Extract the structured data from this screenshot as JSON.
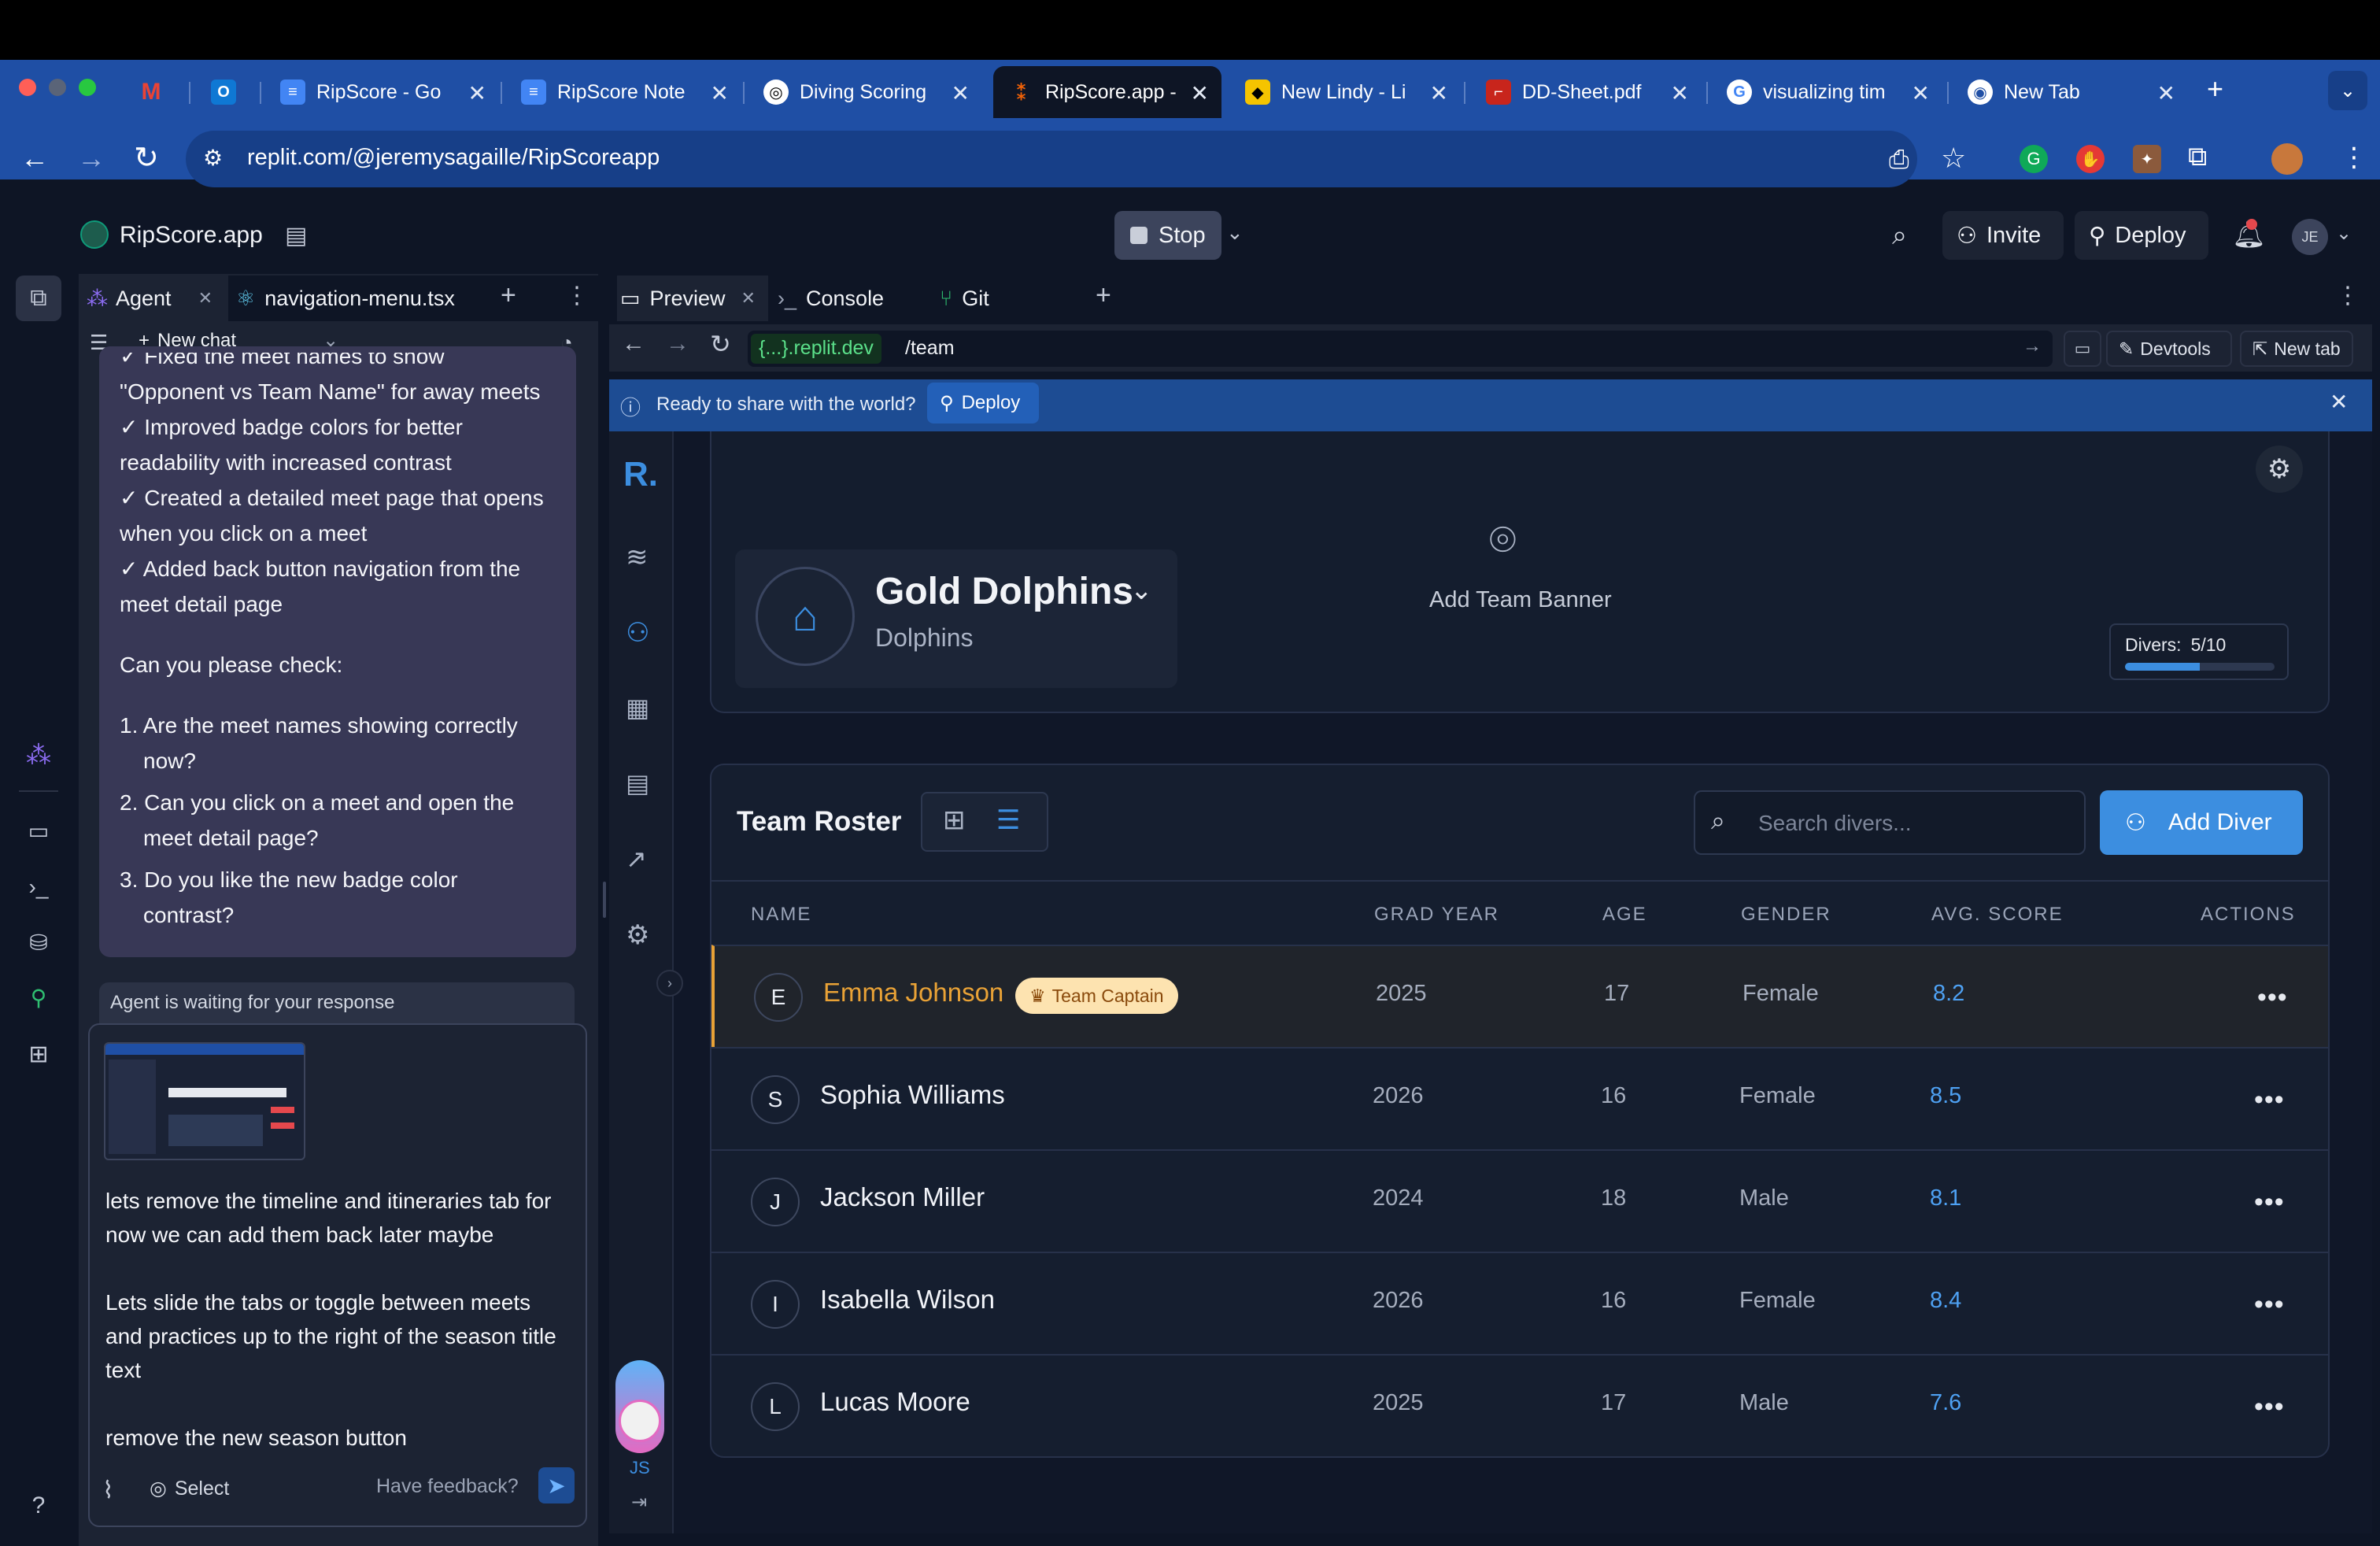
{
  "browser": {
    "tabs": [
      {
        "label": "",
        "icon": "gmail-icon"
      },
      {
        "label": "",
        "icon": "outlook-icon"
      },
      {
        "label": "RipScore - Go",
        "icon": "docs-icon"
      },
      {
        "label": "RipScore Note",
        "icon": "docs-icon"
      },
      {
        "label": "Diving Scoring",
        "icon": "openai-icon"
      },
      {
        "label": "RipScore.app -",
        "icon": "replit-icon"
      },
      {
        "label": "New Lindy - Li",
        "icon": "lindy-icon"
      },
      {
        "label": "DD-Sheet.pdf",
        "icon": "pdf-icon"
      },
      {
        "label": "visualizing tim",
        "icon": "google-icon"
      },
      {
        "label": "New Tab",
        "icon": "chrome-icon"
      }
    ],
    "url": "replit.com/@jeremysagaille/RipScoreapp"
  },
  "replit": {
    "project_name": "RipScore.app",
    "stop_label": "Stop",
    "invite_label": "Invite",
    "deploy_label": "Deploy",
    "avatar_initials": "JE"
  },
  "left_panel": {
    "tab_agent": "Agent",
    "tab_file": "navigation-menu.tsx",
    "new_chat": "New chat",
    "chat_lines": [
      "✓ Fixed the meet names to show",
      "\"Opponent vs Team Name\" for away meets",
      "✓ Improved badge colors for better",
      "readability with increased contrast",
      "✓ Created a detailed meet page that opens",
      "when you click on a meet",
      "✓ Added back button navigation from the",
      "meet detail page"
    ],
    "check_prompt": "Can you please check:",
    "check_items": [
      [
        "1. Are the meet names showing correctly",
        "now?"
      ],
      [
        "2. Can you click on a meet and open the",
        "meet detail page?"
      ],
      [
        "3. Do you like the new badge color",
        "contrast?"
      ]
    ],
    "waiting": "Agent is waiting for your response",
    "message_lines": [
      "lets remove the timeline and itineraries tab for",
      "now we can add them back later maybe",
      "",
      "Lets slide the tabs or toggle between meets",
      "and practices up to the right of the season title",
      "text",
      "",
      "remove the new season button"
    ],
    "select_label": "Select",
    "feedback_label": "Have feedback?"
  },
  "right_panel": {
    "tab_preview": "Preview",
    "tab_console": "Console",
    "tab_git": "Git",
    "url_host": "{...}.replit.dev",
    "url_path": "/team",
    "devtools": "Devtools",
    "new_tab": "New tab",
    "banner_text": "Ready to share with the world?",
    "banner_deploy": "Deploy",
    "side_initials": "JS"
  },
  "app": {
    "logo": "R.",
    "team_name": "Gold Dolphins",
    "team_sub": "Dolphins",
    "add_banner": "Add Team Banner",
    "divers_label": "Divers:",
    "divers_value": "5/10",
    "divers_fraction": 0.5,
    "roster_title": "Team Roster",
    "search_placeholder": "Search divers...",
    "add_diver": "Add Diver",
    "columns": [
      "NAME",
      "GRAD YEAR",
      "AGE",
      "GENDER",
      "AVG. SCORE",
      "ACTIONS"
    ],
    "captain_badge": "Team Captain",
    "accent": "#3c8ee0",
    "captain_color": "#e9a236",
    "rows": [
      {
        "initial": "E",
        "name": "Emma Johnson",
        "year": "2025",
        "age": "17",
        "gender": "Female",
        "score": "8.2",
        "captain": true
      },
      {
        "initial": "S",
        "name": "Sophia Williams",
        "year": "2026",
        "age": "16",
        "gender": "Female",
        "score": "8.5"
      },
      {
        "initial": "J",
        "name": "Jackson Miller",
        "year": "2024",
        "age": "18",
        "gender": "Male",
        "score": "8.1"
      },
      {
        "initial": "I",
        "name": "Isabella Wilson",
        "year": "2026",
        "age": "16",
        "gender": "Female",
        "score": "8.4"
      },
      {
        "initial": "L",
        "name": "Lucas Moore",
        "year": "2025",
        "age": "17",
        "gender": "Male",
        "score": "7.6"
      }
    ]
  }
}
